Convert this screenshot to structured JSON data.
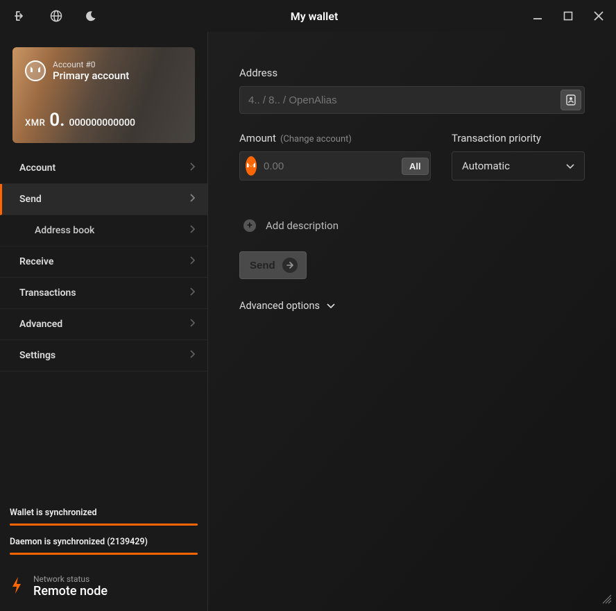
{
  "titlebar": {
    "title": "My wallet"
  },
  "account": {
    "number_label": "Account #0",
    "name": "Primary account",
    "currency": "XMR",
    "balance_whole": "0.",
    "balance_frac": "000000000000"
  },
  "nav": {
    "account": "Account",
    "send": "Send",
    "address_book": "Address book",
    "receive": "Receive",
    "transactions": "Transactions",
    "advanced": "Advanced",
    "settings": "Settings"
  },
  "status": {
    "wallet_label": "Wallet is synchronized",
    "daemon_label": "Daemon is synchronized (2139429)",
    "network_status_label": "Network status",
    "network_status_value": "Remote node"
  },
  "form": {
    "address_label": "Address",
    "address_placeholder": "4.. / 8.. / OpenAlias",
    "amount_label": "Amount",
    "amount_hint": "(Change account)",
    "amount_placeholder": "0.00",
    "all_button": "All",
    "priority_label": "Transaction priority",
    "priority_value": "Automatic",
    "add_description": "Add description",
    "send_button": "Send",
    "advanced_options": "Advanced options"
  },
  "colors": {
    "accent": "#ff6600"
  }
}
